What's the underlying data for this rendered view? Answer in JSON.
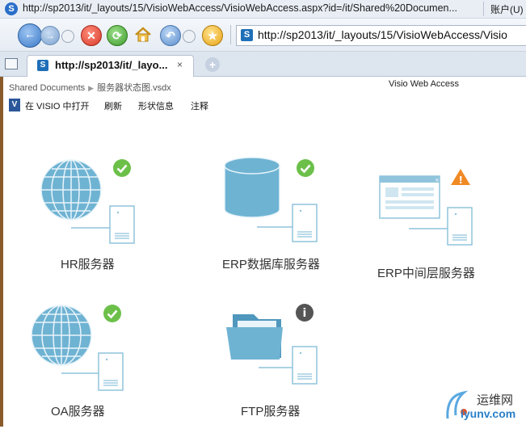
{
  "window": {
    "title": "http://sp2013/it/_layouts/15/VisioWebAccess/VisioWebAccess.aspx?id=/it/Shared%20Documen...",
    "account_menu": "账户(U)"
  },
  "address_bar": {
    "url": "http://sp2013/it/_layouts/15/VisioWebAccess/Visio"
  },
  "tab": {
    "label": "http://sp2013/it/_layo...",
    "close": "×",
    "new_tab": "+"
  },
  "breadcrumb": {
    "library": "Shared Documents",
    "file": "服务器状态图.vsdx"
  },
  "app_label": "Visio Web Access",
  "toolbar": {
    "open_in_visio": "在 VISIO 中打开",
    "refresh": "刷新",
    "shape_info": "形状信息",
    "comments": "注释"
  },
  "servers": [
    {
      "name": "HR服务器",
      "icon": "globe-server-icon",
      "status": "ok"
    },
    {
      "name": "ERP数据库服务器",
      "icon": "database-server-icon",
      "status": "ok"
    },
    {
      "name": "ERP中间层服务器",
      "icon": "webpage-server-icon",
      "status": "warning"
    },
    {
      "name": "OA服务器",
      "icon": "globe-server-icon",
      "status": "ok"
    },
    {
      "name": "FTP服务器",
      "icon": "folder-server-icon",
      "status": "info"
    }
  ],
  "watermark": {
    "top": "运维网",
    "bottom": "iyunv.com"
  },
  "colors": {
    "shape_fill": "#6fb3d3",
    "status_ok": "#6cc04a",
    "status_warning": "#f08a24",
    "status_info": "#555555"
  }
}
